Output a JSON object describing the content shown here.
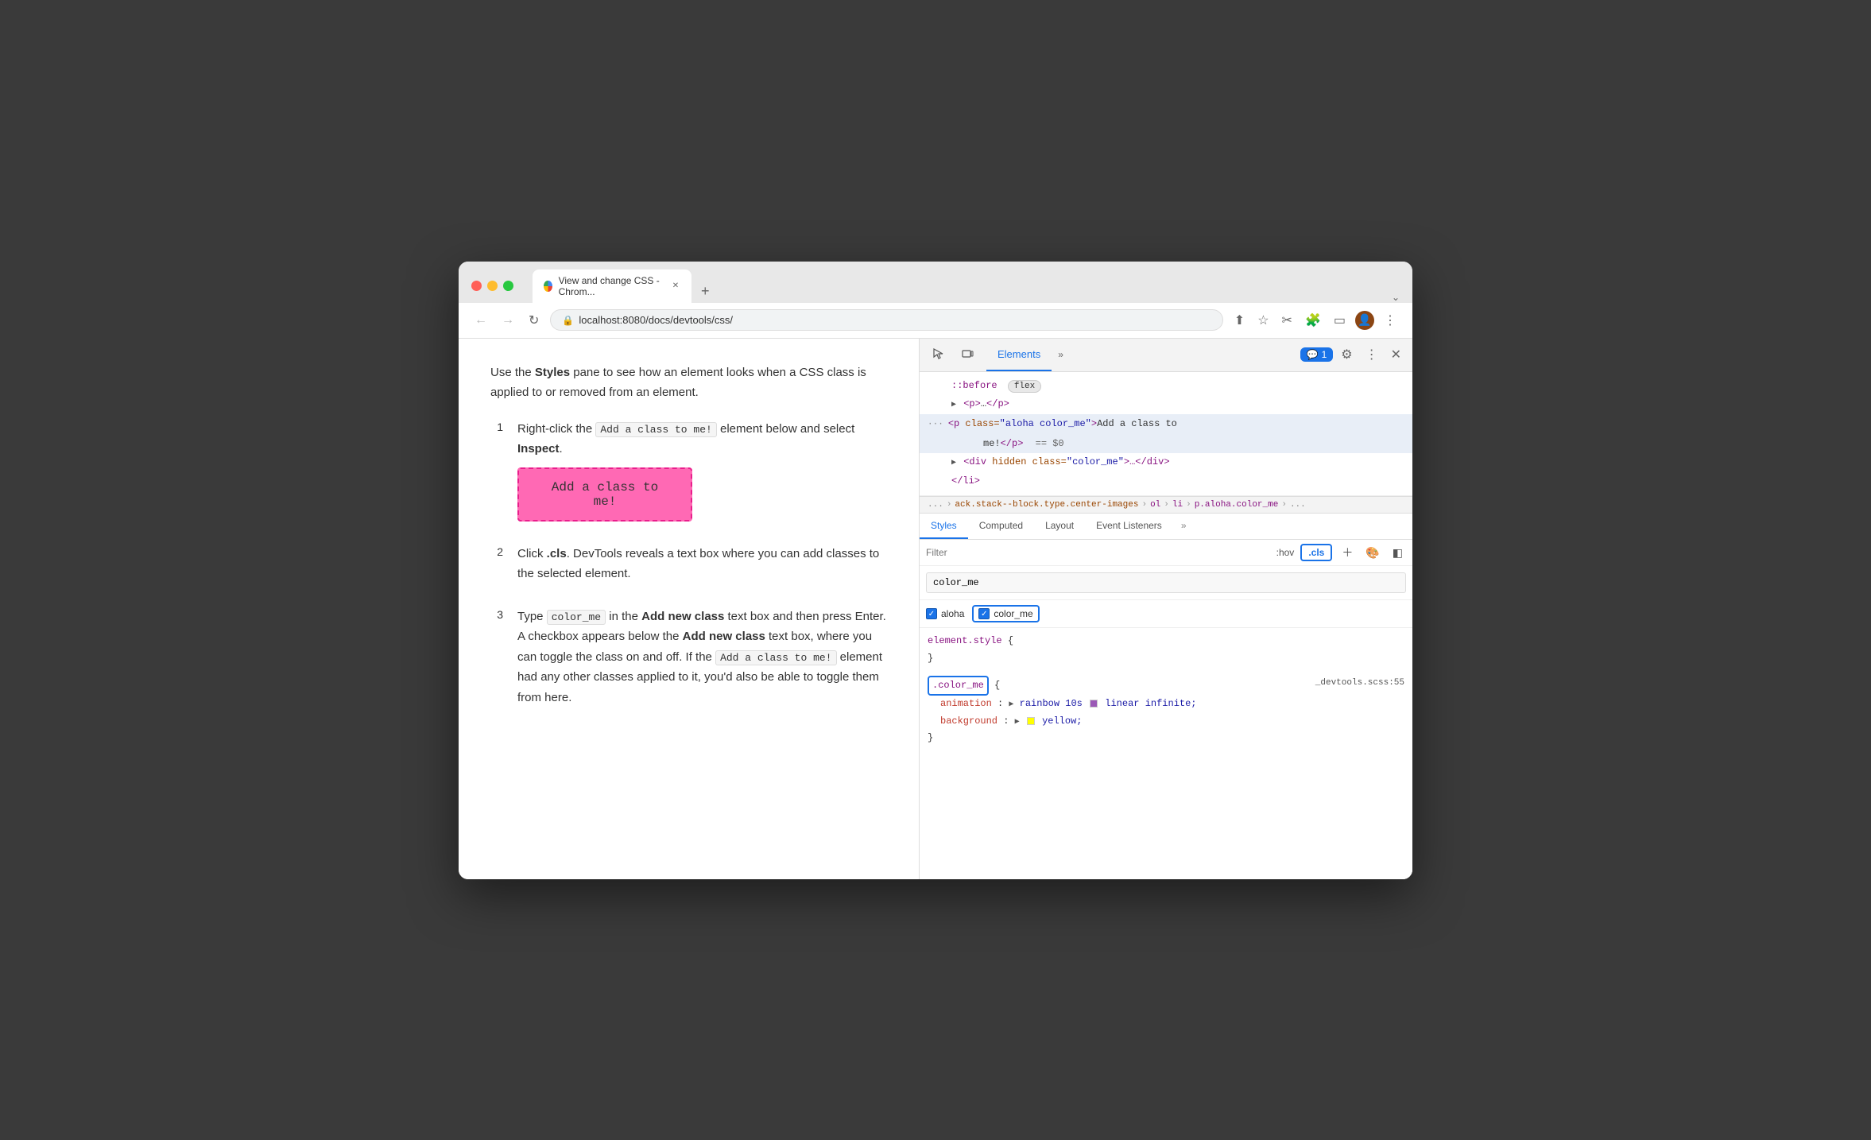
{
  "browser": {
    "tab_title": "View and change CSS - Chrom...",
    "url": "localhost:8080/docs/devtools/css/",
    "nav_back": "←",
    "nav_forward": "→",
    "nav_refresh": "↻",
    "new_tab": "+",
    "tab_dropdown": "⌄"
  },
  "page": {
    "intro_text_1": "Use the ",
    "intro_bold": "Styles",
    "intro_text_2": " pane to see how an element looks when a CSS class is applied to or removed from an element.",
    "steps": [
      {
        "number": "1",
        "text_1": "Right-click the ",
        "code_1": "Add a class to me!",
        "text_2": " element below and select ",
        "bold_1": "Inspect",
        "text_3": "."
      },
      {
        "number": "2",
        "text_1": "Click ",
        "bold_1": ".cls",
        "text_2": ". DevTools reveals a text box where you can add classes to the selected element."
      },
      {
        "number": "3",
        "text_1": "Type ",
        "code_1": "color_me",
        "text_2": " in the ",
        "bold_1": "Add new class",
        "text_3": " text box and then press Enter. A checkbox appears below the ",
        "bold_2": "Add new class",
        "text_4": " text box, where you can toggle the class on and off. If the ",
        "code_2": "Add a class to me!",
        "text_5": " element had any other classes applied to it, you'd also be able to toggle them from here."
      }
    ],
    "demo_button_text": "Add a class to me!"
  },
  "devtools": {
    "header": {
      "cursor_icon": "⬚",
      "device_icon": "▭",
      "elements_tab": "Elements",
      "more_tabs": "»",
      "chat_badge": "1",
      "gear_icon": "⚙",
      "more_icon": "⋮",
      "close_icon": "✕"
    },
    "dom": {
      "rows": [
        {
          "indent": 2,
          "content": "::before",
          "tag_class": "pseudo",
          "extra": "flex"
        },
        {
          "indent": 2,
          "has_arrow": true,
          "content": "<p>…</p>"
        },
        {
          "indent": 1,
          "dots": "···",
          "content": "<p class=\"aloha color_me\">Add a class to me!</p>",
          "selected": true,
          "eq": "== $0"
        },
        {
          "indent": 2,
          "has_arrow": true,
          "content": "<div hidden class=\"color_me\">…</div>"
        },
        {
          "indent": 2,
          "content": "</li>"
        }
      ]
    },
    "breadcrumb": {
      "items": [
        "...",
        "ack.stack--block.type.center-images",
        "ol",
        "li",
        "p.aloha.color_me",
        "..."
      ]
    },
    "styles_tabs": [
      "Styles",
      "Computed",
      "Layout",
      "Event Listeners",
      "»"
    ],
    "filter": {
      "placeholder": "Filter",
      "hov_text": ":hov",
      "cls_label": ".cls"
    },
    "class_input_value": "color_me",
    "classes": [
      {
        "name": "aloha",
        "checked": true
      },
      {
        "name": "color_me",
        "checked": true,
        "outlined": true
      }
    ],
    "css_rules": [
      {
        "selector": "element.style",
        "open": "{",
        "close": "}",
        "props": []
      },
      {
        "selector": ".color_me",
        "selector_outlined": true,
        "open": "{",
        "close": "}",
        "file": "_devtools.scss:55",
        "props": [
          {
            "name": "animation",
            "value": "rainbow 10s",
            "has_swatch_purple": true,
            "value2": "linear infinite;"
          },
          {
            "name": "background",
            "value": "yellow;",
            "has_triangle": true,
            "has_swatch": true,
            "swatch_color": "#ffff00"
          }
        ]
      }
    ]
  }
}
